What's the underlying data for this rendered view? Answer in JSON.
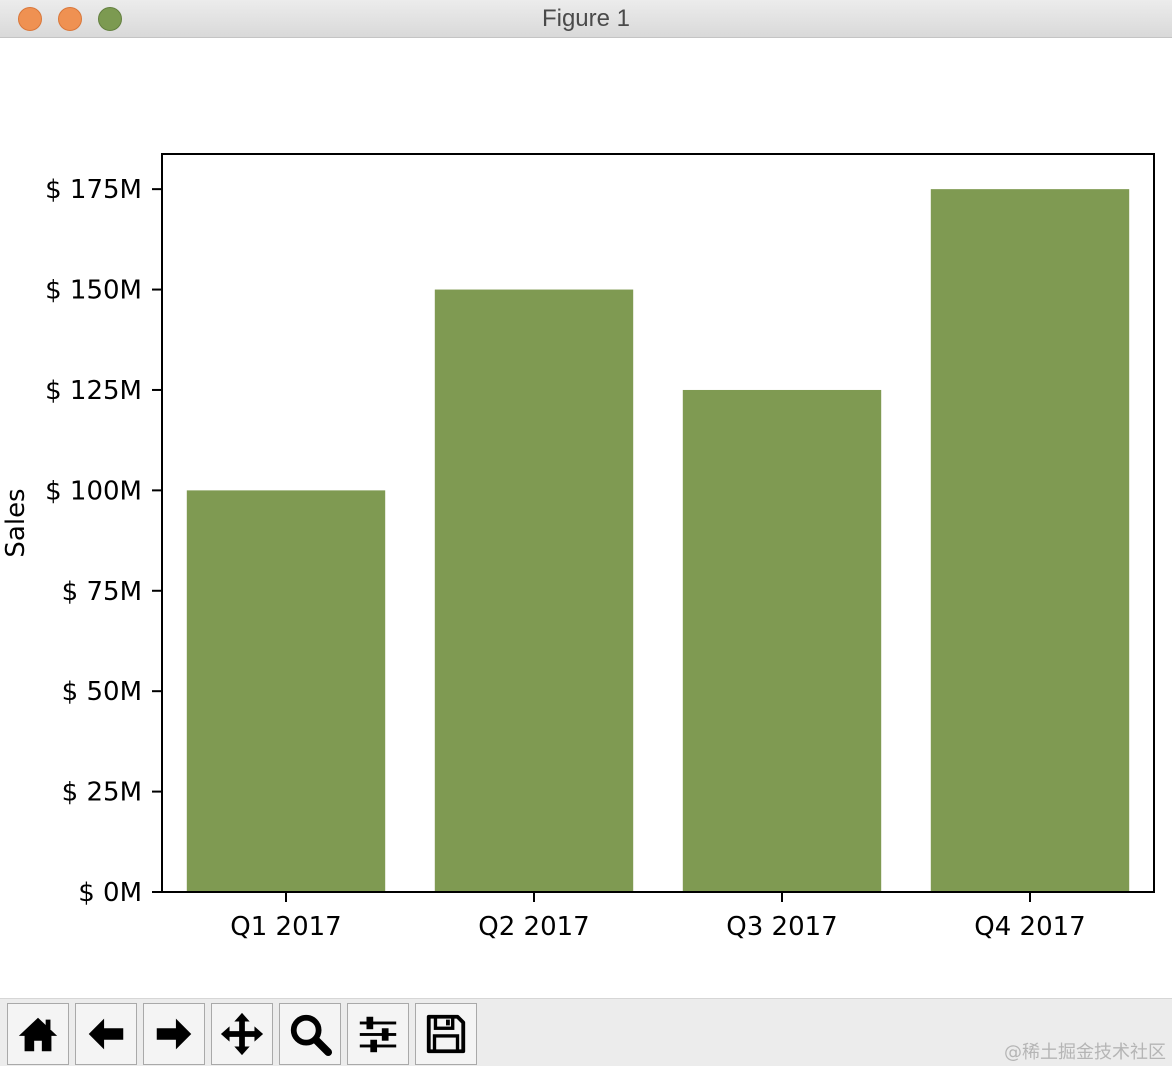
{
  "window": {
    "title": "Figure 1"
  },
  "chart_data": {
    "type": "bar",
    "categories": [
      "Q1 2017",
      "Q2 2017",
      "Q3 2017",
      "Q4 2017"
    ],
    "values": [
      100,
      150,
      125,
      175
    ],
    "value_unit": "millions USD",
    "title": "",
    "xlabel": "",
    "ylabel": "Sales",
    "ylim": [
      0,
      183.75
    ],
    "yticks": [
      0,
      25,
      50,
      75,
      100,
      125,
      150,
      175
    ],
    "ytick_labels": [
      "$ 0M",
      "$ 25M",
      "$ 50M",
      "$ 75M",
      "$ 100M",
      "$ 125M",
      "$ 150M",
      "$ 175M"
    ],
    "grid": false,
    "bar_color": "#7f9a52"
  },
  "toolbar": {
    "buttons": [
      {
        "name": "home",
        "icon": "home-icon"
      },
      {
        "name": "back",
        "icon": "arrow-left-icon"
      },
      {
        "name": "forward",
        "icon": "arrow-right-icon"
      },
      {
        "name": "pan",
        "icon": "move-icon"
      },
      {
        "name": "zoom",
        "icon": "magnifier-icon"
      },
      {
        "name": "configure-subplots",
        "icon": "sliders-icon"
      },
      {
        "name": "save",
        "icon": "floppy-disk-icon"
      }
    ]
  },
  "watermark": "@稀土掘金技术社区"
}
